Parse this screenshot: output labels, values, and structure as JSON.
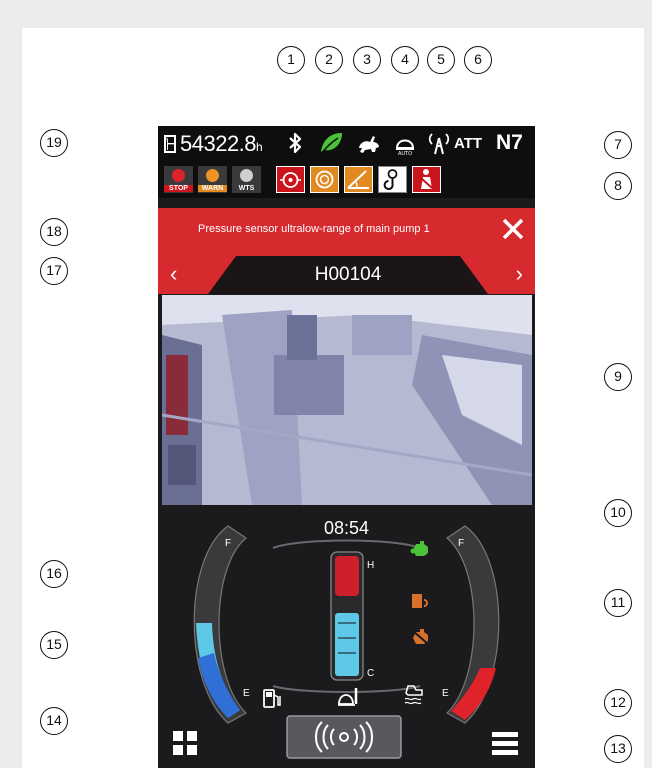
{
  "status_bar": {
    "hour_meter": "54322.8",
    "hour_unit": "h",
    "attachment_label": "ATT",
    "gear_label": "N7"
  },
  "warning_lamps": [
    {
      "label": "STOP",
      "color": "#c9151b"
    },
    {
      "label": "WARN",
      "color": "#e28a22"
    },
    {
      "label": "WTS",
      "color": "#b0b0b0"
    }
  ],
  "alarm": {
    "message": "Pressure sensor ultralow-range of main pump 1",
    "code": "H00104"
  },
  "clock": "08:54",
  "gauges": {
    "fuel_full": "F",
    "fuel_empty": "E",
    "temp_hot": "H",
    "temp_cold": "C",
    "def_full": "F",
    "def_empty": "E"
  },
  "callouts": [
    "1",
    "2",
    "3",
    "4",
    "5",
    "6",
    "7",
    "8",
    "9",
    "10",
    "11",
    "12",
    "13",
    "14",
    "15",
    "16",
    "17",
    "18",
    "19"
  ],
  "colors": {
    "alarm_red": "#d72a2f",
    "eco_green": "#4cc23a",
    "coolant_blue": "#5ec9e6",
    "screen_dark": "#1b1b1d"
  }
}
